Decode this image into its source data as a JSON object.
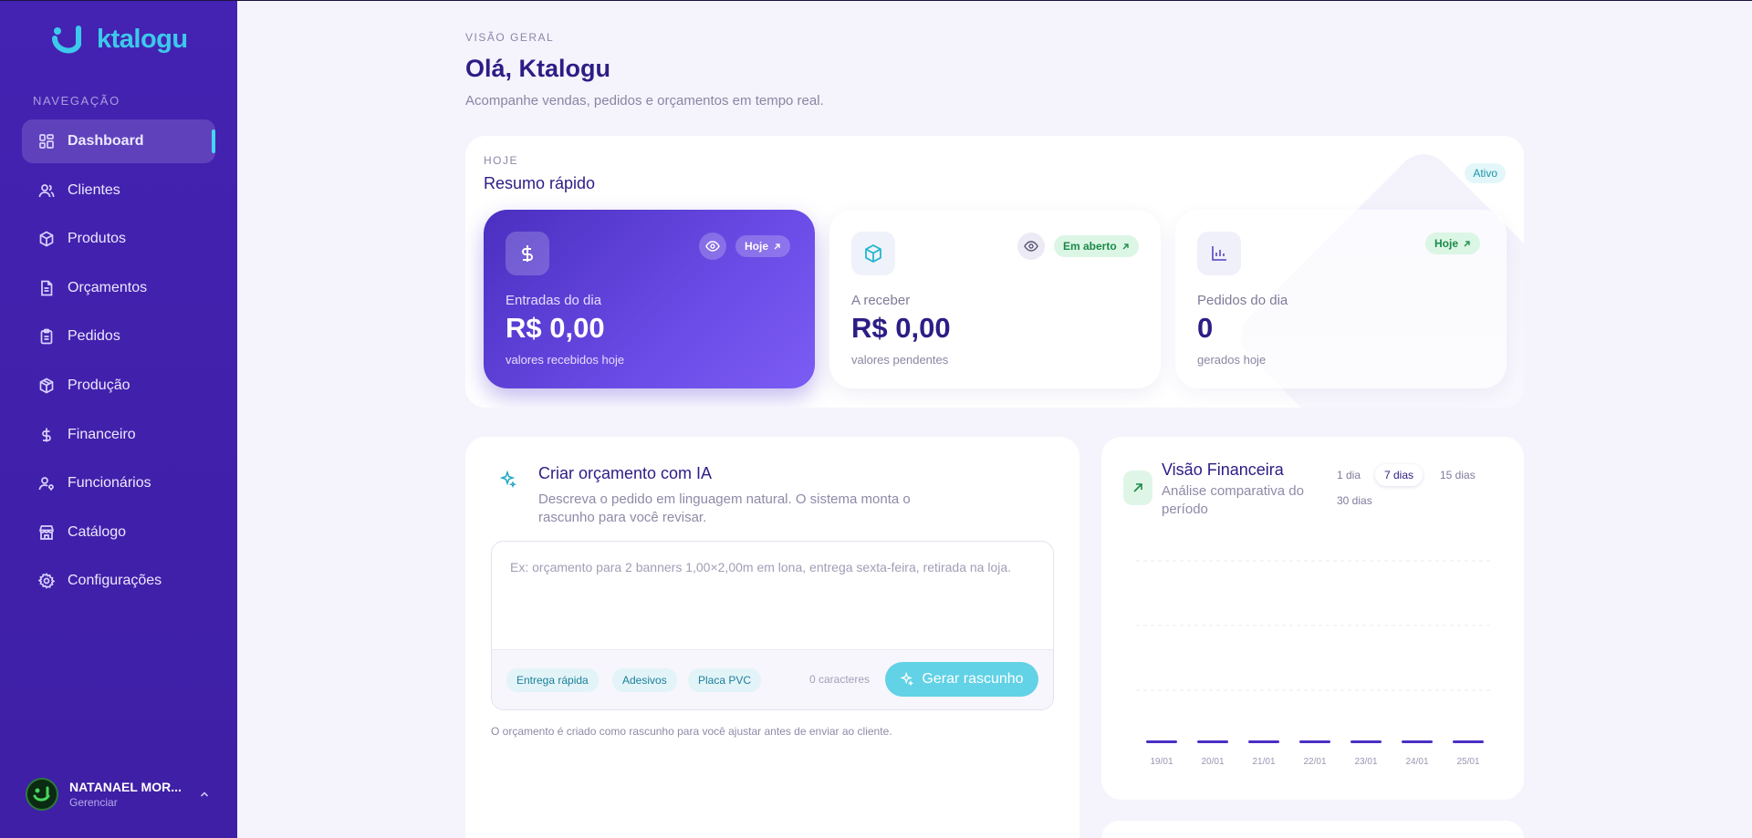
{
  "app": {
    "logo_text": "ktalogu"
  },
  "sidebar": {
    "nav_title": "NAVEGAÇÃO",
    "items": [
      {
        "label": "Dashboard",
        "icon": "dashboard-icon",
        "active": true
      },
      {
        "label": "Clientes",
        "icon": "users-icon"
      },
      {
        "label": "Produtos",
        "icon": "box-icon"
      },
      {
        "label": "Orçamentos",
        "icon": "document-icon"
      },
      {
        "label": "Pedidos",
        "icon": "clipboard-icon"
      },
      {
        "label": "Produção",
        "icon": "package-icon"
      },
      {
        "label": "Financeiro",
        "icon": "dollar-icon"
      },
      {
        "label": "Funcionários",
        "icon": "user-key-icon"
      },
      {
        "label": "Catálogo",
        "icon": "store-icon"
      },
      {
        "label": "Configurações",
        "icon": "gear-icon"
      }
    ],
    "user": {
      "name": "NATANAEL MOR...",
      "subtitle": "Gerenciar"
    }
  },
  "header": {
    "eyebrow": "VISÃO GERAL",
    "greeting": "Olá, Ktalogu",
    "subtitle": "Acompanhe vendas, pedidos e orçamentos em tempo real."
  },
  "resumo": {
    "eyebrow": "HOJE",
    "title": "Resumo rápido",
    "status": "Ativo",
    "cards": [
      {
        "label": "Entradas do dia",
        "value": "R$ 0,00",
        "note": "valores recebidos hoje",
        "badge": "Hoje",
        "icon": "dollar-icon"
      },
      {
        "label": "A receber",
        "value": "R$ 0,00",
        "note": "valores pendentes",
        "badge": "Em aberto",
        "icon": "box-icon"
      },
      {
        "label": "Pedidos do dia",
        "value": "0",
        "note": "gerados hoje",
        "badge": "Hoje",
        "icon": "bar-chart-icon"
      }
    ]
  },
  "ia": {
    "title": "Criar orçamento com IA",
    "description": "Descreva o pedido em linguagem natural. O sistema monta o rascunho para você revisar.",
    "placeholder": "Ex: orçamento para 2 banners 1,00×2,00m em lona, entrega sexta-feira, retirada na loja.",
    "chips": [
      "Entrega rápida",
      "Adesivos",
      "Placa PVC"
    ],
    "char_count": "0 caracteres",
    "button": "Gerar rascunho",
    "hint": "O orçamento é criado como rascunho para você ajustar antes de enviar ao cliente."
  },
  "financeira": {
    "title": "Visão Financeira",
    "subtitle": "Análise comparativa do período",
    "tabs": [
      "1 dia",
      "7 dias",
      "15 dias",
      "30 dias"
    ],
    "active_tab": "7 dias",
    "colors": {
      "bar": "#4b2fc4"
    }
  },
  "chart_data": {
    "type": "bar",
    "categories": [
      "19/01",
      "20/01",
      "21/01",
      "22/01",
      "23/01",
      "24/01",
      "25/01"
    ],
    "values": [
      0,
      0,
      0,
      0,
      0,
      0,
      0
    ],
    "title": "",
    "xlabel": "",
    "ylabel": "",
    "grid": true
  }
}
